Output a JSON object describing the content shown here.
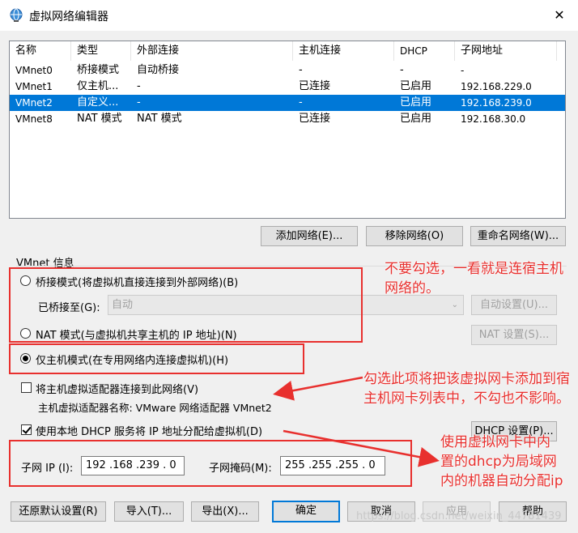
{
  "window": {
    "title": "虚拟网络编辑器",
    "close_glyph": "✕"
  },
  "list": {
    "columns": [
      "名称",
      "类型",
      "外部连接",
      "主机连接",
      "DHCP",
      "子网地址"
    ],
    "rows": [
      {
        "name": "VMnet0",
        "type": "桥接模式",
        "ext": "自动桥接",
        "host": "-",
        "dhcp": "-",
        "subnet": "-",
        "selected": false
      },
      {
        "name": "VMnet1",
        "type": "仅主机...",
        "ext": "-",
        "host": "已连接",
        "dhcp": "已启用",
        "subnet": "192.168.229.0",
        "selected": false
      },
      {
        "name": "VMnet2",
        "type": "自定义...",
        "ext": "-",
        "host": "-",
        "dhcp": "已启用",
        "subnet": "192.168.239.0",
        "selected": true
      },
      {
        "name": "VMnet8",
        "type": "NAT 模式",
        "ext": "NAT 模式",
        "host": "已连接",
        "dhcp": "已启用",
        "subnet": "192.168.30.0",
        "selected": false
      }
    ]
  },
  "list_buttons": {
    "add": "添加网络(E)...",
    "remove": "移除网络(O)",
    "rename": "重命名网络(W)..."
  },
  "vmnet_info": {
    "label": "VMnet 信息",
    "bridged_radio": "桥接模式(将虚拟机直接连接到外部网络)(B)",
    "bridged_to_label": "已桥接至(G):",
    "bridged_to_value": "自动",
    "auto_settings": "自动设置(U)...",
    "nat_radio": "NAT 模式(与虚拟机共享主机的 IP 地址)(N)",
    "nat_settings": "NAT 设置(S)...",
    "hostonly_radio": "仅主机模式(在专用网络内连接虚拟机)(H)",
    "connect_adapter_check": "将主机虚拟适配器连接到此网络(V)",
    "adapter_name": "主机虚拟适配器名称: VMware 网络适配器 VMnet2",
    "dhcp_check": "使用本地 DHCP 服务将 IP 地址分配给虚拟机(D)",
    "dhcp_settings": "DHCP 设置(P)...",
    "subnet_ip_label": "子网 IP (I):",
    "subnet_ip_value": "192 .168 .239 .  0",
    "subnet_mask_label": "子网掩码(M):",
    "subnet_mask_value": "255 .255 .255 .  0"
  },
  "bottom_buttons": {
    "restore": "还原默认设置(R)",
    "import": "导入(T)...",
    "export": "导出(X)...",
    "ok": "确定",
    "cancel": "取消",
    "apply": "应用",
    "help": "帮助"
  },
  "annotations": {
    "a1": "不要勾选，一看就是连宿主机网络的。",
    "a2": "勾选此项将把该虚拟网卡添加到宿主机网卡列表中，不勾也不影响。",
    "a3": "使用虚拟网卡中内置的dhcp为局域网内的机器自动分配ip"
  },
  "watermark": "https://blog.csdn.net/weixin_44781439",
  "colors": {
    "selection": "#0078d7",
    "annotation": "#e8302e",
    "default_button_border": "#0078d7"
  }
}
